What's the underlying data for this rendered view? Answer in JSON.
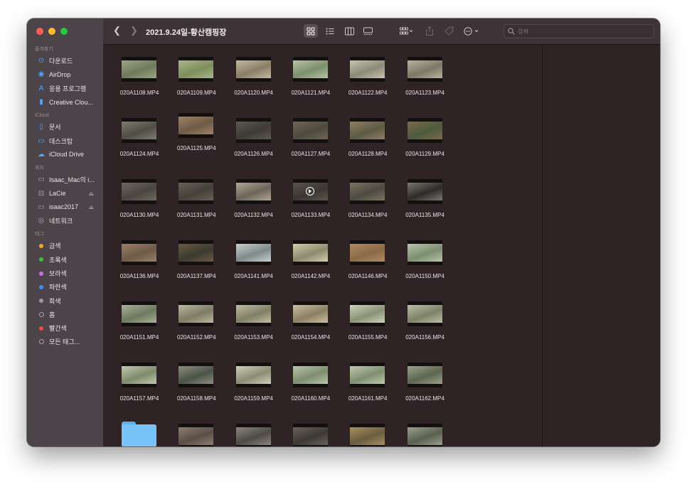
{
  "window": {
    "title": "2021.9.24일-황산캠핑장",
    "search_placeholder": "검색"
  },
  "sidebar": {
    "sections": [
      {
        "title": "즐겨찾기",
        "items": [
          {
            "label": "다운로드",
            "icon": "download-icon",
            "glyph": "⊙"
          },
          {
            "label": "AirDrop",
            "icon": "airdrop-icon",
            "glyph": "◉"
          },
          {
            "label": "응용 프로그램",
            "icon": "applications-icon",
            "glyph": "A"
          },
          {
            "label": "Creative Clou...",
            "icon": "document-icon",
            "glyph": "▮"
          }
        ]
      },
      {
        "title": "iCloud",
        "items": [
          {
            "label": "문서",
            "icon": "document-icon",
            "glyph": "▯"
          },
          {
            "label": "데스크탑",
            "icon": "desktop-icon",
            "glyph": "▭"
          },
          {
            "label": "iCloud Drive",
            "icon": "cloud-icon",
            "glyph": "☁"
          }
        ]
      },
      {
        "title": "위치",
        "items": [
          {
            "label": "Isaac_Mac의 i...",
            "icon": "computer-icon",
            "glyph": "▭"
          },
          {
            "label": "LaCie",
            "icon": "drive-icon",
            "glyph": "⊟",
            "eject": true
          },
          {
            "label": "isaac2017",
            "icon": "display-icon",
            "glyph": "▭",
            "eject": true
          },
          {
            "label": "네트워크",
            "icon": "network-icon",
            "glyph": "◎"
          }
        ]
      },
      {
        "title": "태그",
        "items": [
          {
            "label": "금색",
            "color": "#f5a623"
          },
          {
            "label": "초록색",
            "color": "#3bc14a"
          },
          {
            "label": "보라색",
            "color": "#c86ee0"
          },
          {
            "label": "파란색",
            "color": "#3a8ff7"
          },
          {
            "label": "회색",
            "color": "#9a9a9a"
          },
          {
            "label": "홈",
            "color": "hollow"
          },
          {
            "label": "빨간색",
            "color": "#ef4b46"
          },
          {
            "label": "모든 태그...",
            "color": "alltags"
          }
        ]
      }
    ]
  },
  "files": [
    {
      "name": "020A1108.MP4",
      "colors": [
        "#6e7a5a",
        "#9aa684"
      ]
    },
    {
      "name": "020A1109.MP4",
      "colors": [
        "#7d8e5b",
        "#a9b88a"
      ]
    },
    {
      "name": "020A1120.MP4",
      "colors": [
        "#8a7e66",
        "#c5b9a0"
      ]
    },
    {
      "name": "020A1121.MP4",
      "colors": [
        "#7c8f6c",
        "#b6c4a6"
      ]
    },
    {
      "name": "020A1122.MP4",
      "colors": [
        "#8b8a78",
        "#c7c4b0"
      ]
    },
    {
      "name": "020A1123.MP4",
      "colors": [
        "#7d7766",
        "#b8b2a0"
      ]
    },
    {
      "name": "020A1124.MP4",
      "colors": [
        "#4f4d45",
        "#807c70"
      ]
    },
    {
      "name": "020A1125.MP4",
      "colors": [
        "#6e5a45",
        "#9c8468"
      ]
    },
    {
      "name": "020A1126.MP4",
      "colors": [
        "#3e3a34",
        "#5e5a52"
      ]
    },
    {
      "name": "020A1127.MP4",
      "colors": [
        "#4e4a40",
        "#6f6554"
      ]
    },
    {
      "name": "020A1128.MP4",
      "colors": [
        "#5d5a44",
        "#8d7f62"
      ]
    },
    {
      "name": "020A1129.MP4",
      "colors": [
        "#4c5a3c",
        "#7d6a4c"
      ]
    },
    {
      "name": "020A1130.MP4",
      "colors": [
        "#4a4540",
        "#6f6860"
      ]
    },
    {
      "name": "020A1131.MP4",
      "colors": [
        "#45403a",
        "#6a6058"
      ]
    },
    {
      "name": "020A1132.MP4",
      "colors": [
        "#6e655a",
        "#b0a696"
      ]
    },
    {
      "name": "020A1133.MP4",
      "colors": [
        "#3b3632",
        "#5a544c"
      ],
      "play": true
    },
    {
      "name": "020A1134.MP4",
      "colors": [
        "#4d4a40",
        "#7a7464"
      ]
    },
    {
      "name": "020A1135.MP4",
      "colors": [
        "#2e2b28",
        "#7a7870"
      ]
    },
    {
      "name": "020A1136.MP4",
      "colors": [
        "#6e5a48",
        "#9a8068"
      ]
    },
    {
      "name": "020A1137.MP4",
      "colors": [
        "#3a3a30",
        "#6a5c40"
      ]
    },
    {
      "name": "020A1141.MP4",
      "colors": [
        "#7d8a8c",
        "#c9d0cc"
      ]
    },
    {
      "name": "020A1142.MP4",
      "colors": [
        "#8c8a6e",
        "#d4ccb0"
      ]
    },
    {
      "name": "020A1146.MP4",
      "colors": [
        "#8a6a48",
        "#b08a62"
      ]
    },
    {
      "name": "020A1150.MP4",
      "colors": [
        "#7c8e70",
        "#b9c6ac"
      ]
    },
    {
      "name": "020A1151.MP4",
      "colors": [
        "#6d7a60",
        "#a8b294"
      ]
    },
    {
      "name": "020A1152.MP4",
      "colors": [
        "#7e7c66",
        "#bcb69a"
      ]
    },
    {
      "name": "020A1153.MP4",
      "colors": [
        "#808068",
        "#c0bc9e"
      ]
    },
    {
      "name": "020A1154.MP4",
      "colors": [
        "#8a7e64",
        "#ccc0a2"
      ]
    },
    {
      "name": "020A1155.MP4",
      "colors": [
        "#8a9276",
        "#cdd2b8"
      ]
    },
    {
      "name": "020A1156.MP4",
      "colors": [
        "#7c8268",
        "#bcbea6"
      ]
    },
    {
      "name": "020A1157.MP4",
      "colors": [
        "#7f8a6c",
        "#c2c8ae"
      ]
    },
    {
      "name": "020A1158.MP4",
      "colors": [
        "#4d5248",
        "#8a9080"
      ]
    },
    {
      "name": "020A1159.MP4",
      "colors": [
        "#8a8c74",
        "#cfd0ba"
      ]
    },
    {
      "name": "020A1160.MP4",
      "colors": [
        "#7e8c70",
        "#bac6a8"
      ]
    },
    {
      "name": "020A1161.MP4",
      "colors": [
        "#7e8e70",
        "#c0caae"
      ]
    },
    {
      "name": "020A1162.MP4",
      "colors": [
        "#5d6650",
        "#9aa28a"
      ]
    },
    {
      "name": "",
      "folder": true
    },
    {
      "name": "",
      "colors": [
        "#5a4f48",
        "#8c7e70"
      ]
    },
    {
      "name": "",
      "colors": [
        "#4e4a44",
        "#8c8680"
      ]
    },
    {
      "name": "",
      "colors": [
        "#3c3834",
        "#6a625a"
      ]
    },
    {
      "name": "",
      "colors": [
        "#6a5c40",
        "#a89060"
      ]
    },
    {
      "name": "",
      "colors": [
        "#5a6050",
        "#9aa08a"
      ]
    }
  ]
}
